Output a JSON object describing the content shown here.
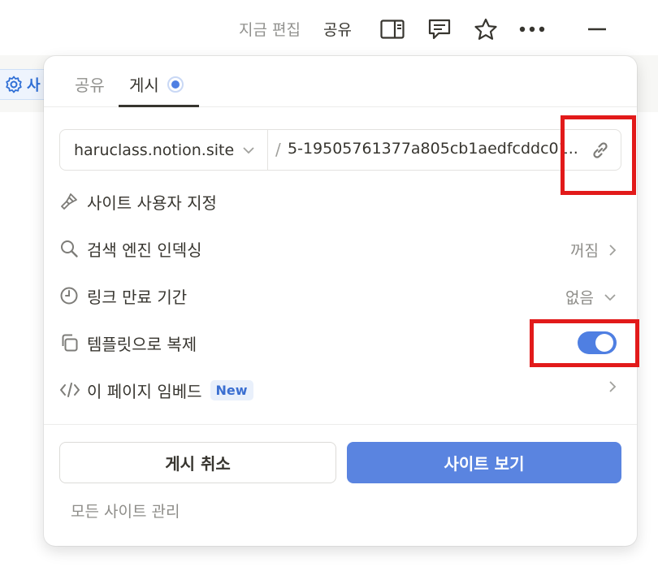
{
  "topbar": {
    "edited_label": "지금 편집",
    "share_label": "공유",
    "icons": [
      "sidebar-panel-icon",
      "comment-icon",
      "star-icon",
      "more-icon",
      "minimize-icon"
    ]
  },
  "background": {
    "chip_label": "사"
  },
  "popover": {
    "tabs": [
      {
        "label": "공유",
        "active": false
      },
      {
        "label": "게시",
        "active": true
      }
    ],
    "url": {
      "domain": "haruclass.notion.site",
      "separator": "/",
      "slug": "5-19505761377a805cb1aedfcddc01..."
    },
    "rows": [
      {
        "icon": "paintbrush-icon",
        "label": "사이트 사용자 지정",
        "value": ""
      },
      {
        "icon": "search-icon",
        "label": "검색 엔진 인덱싱",
        "value": "꺼짐"
      },
      {
        "icon": "clock-icon",
        "label": "링크 만료 기간",
        "value": "없음"
      },
      {
        "icon": "duplicate-icon",
        "label": "템플릿으로 복제",
        "toggle": true
      },
      {
        "icon": "code-icon",
        "label": "이 페이지 임베드",
        "badge": "New"
      }
    ],
    "buttons": {
      "unpublish": "게시 취소",
      "view_site": "사이트 보기"
    },
    "manage_link": "모든 사이트 관리"
  },
  "colors": {
    "accent": "#5a84e0",
    "toggle_on": "#4f7fe2",
    "annotation": "#e21a1a"
  }
}
